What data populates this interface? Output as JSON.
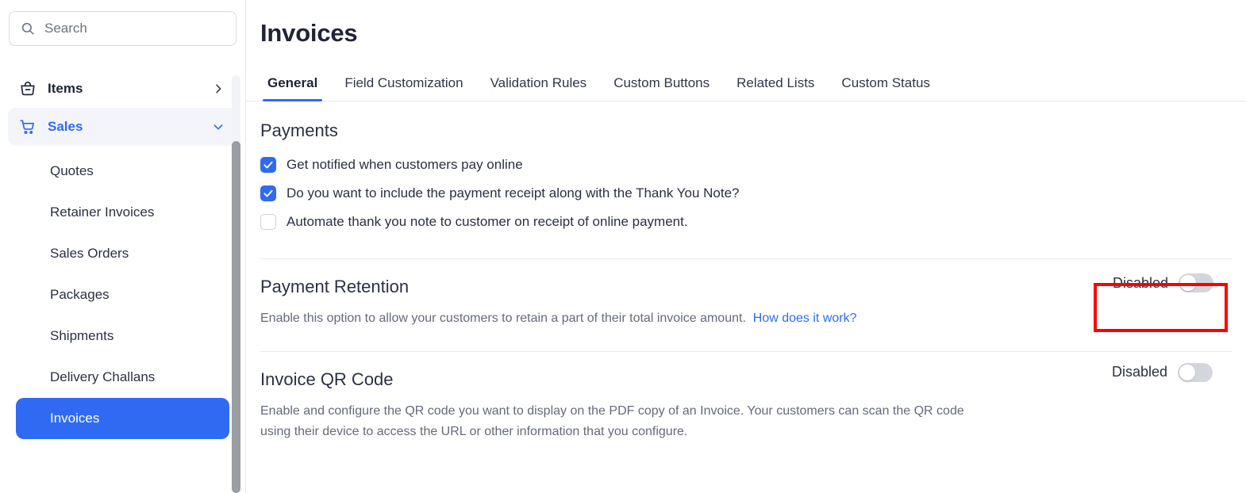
{
  "sidebar": {
    "search": {
      "placeholder": "Search",
      "value": "",
      "icon": "search-icon"
    },
    "groups": [
      {
        "label": "Items",
        "icon": "basket-icon",
        "chevron": "chevron-right-icon",
        "active": false
      },
      {
        "label": "Sales",
        "icon": "shopping-cart-icon",
        "chevron": "chevron-down-icon",
        "active": true
      }
    ],
    "sub_items": [
      {
        "label": "Quotes",
        "selected": false
      },
      {
        "label": "Retainer Invoices",
        "selected": false
      },
      {
        "label": "Sales Orders",
        "selected": false
      },
      {
        "label": "Packages",
        "selected": false
      },
      {
        "label": "Shipments",
        "selected": false
      },
      {
        "label": "Delivery Challans",
        "selected": false
      },
      {
        "label": "Invoices",
        "selected": true
      }
    ]
  },
  "main": {
    "title": "Invoices",
    "tabs": [
      {
        "label": "General",
        "active": true
      },
      {
        "label": "Field Customization",
        "active": false
      },
      {
        "label": "Validation Rules",
        "active": false
      },
      {
        "label": "Custom Buttons",
        "active": false
      },
      {
        "label": "Related Lists",
        "active": false
      },
      {
        "label": "Custom Status",
        "active": false
      }
    ],
    "payments": {
      "heading": "Payments",
      "options": [
        {
          "label": "Get notified when customers pay online",
          "checked": true
        },
        {
          "label": "Do you want to include the payment receipt along with the Thank You Note?",
          "checked": true
        },
        {
          "label": "Automate thank you note to customer on receipt of online payment.",
          "checked": false
        }
      ]
    },
    "payment_retention": {
      "title": "Payment Retention",
      "description": "Enable this option to allow your customers to retain a part of their total invoice amount.",
      "link": "How does it work?",
      "toggle_label": "Disabled",
      "toggle_on": false
    },
    "invoice_qr_code": {
      "title": "Invoice QR Code",
      "description": "Enable and configure the QR code you want to display on the PDF copy of an Invoice. Your customers can scan the QR code using their device to access the URL or other information that you configure.",
      "toggle_label": "Disabled",
      "toggle_on": false
    }
  },
  "annotation": {
    "highlight_color": "#ff0000",
    "target": "payment-retention-toggle"
  },
  "colors": {
    "accent": "#2f6bf2",
    "selected_item_bg": "#2f6bf2",
    "group_active_bg": "#f4f5fb",
    "text_primary": "#1f2335",
    "text_secondary": "#656a7a",
    "divider": "#e9eaef",
    "toggle_off": "#d4d6dd"
  }
}
